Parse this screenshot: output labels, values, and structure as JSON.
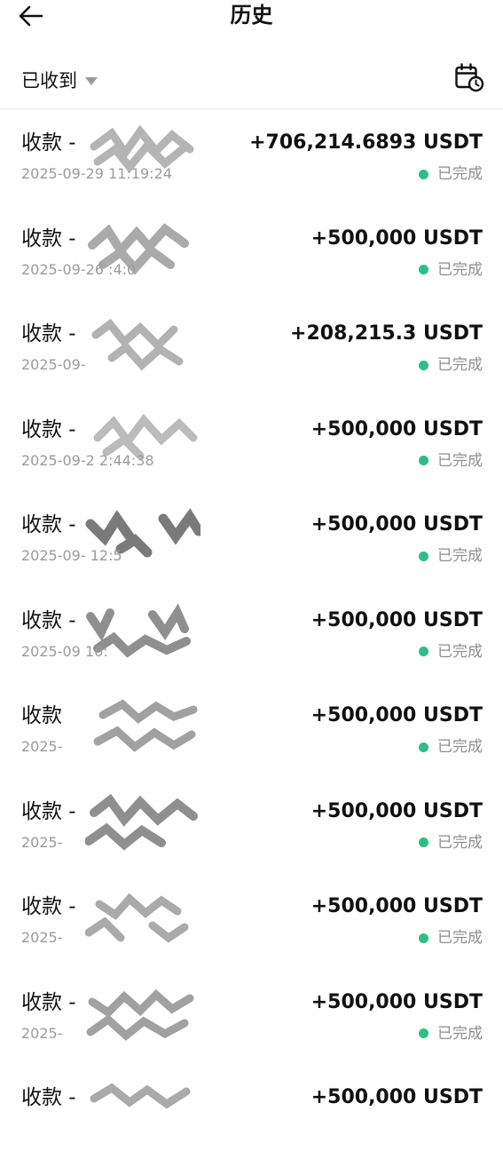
{
  "header": {
    "title": "历史"
  },
  "filter": {
    "label": "已收到"
  },
  "colors": {
    "success": "#2ebd85",
    "muted_text": "#9b9b9b"
  },
  "icons": {
    "back": "arrow-left-icon",
    "calendar": "calendar-clock-icon",
    "dropdown": "caret-down-icon"
  },
  "transactions": [
    {
      "title": "收款 -",
      "time": "2025-09-29 11:19:24",
      "amount": "+706,214.6893 USDT",
      "status": "已完成"
    },
    {
      "title": "收款 -",
      "time": "2025-09-26 :4:0",
      "amount": "+500,000 USDT",
      "status": "已完成"
    },
    {
      "title": "收款 -",
      "time": "2025-09-",
      "amount": "+208,215.3 USDT",
      "status": "已完成"
    },
    {
      "title": "收款 -",
      "time": "2025-09-2 2:44:38",
      "amount": "+500,000 USDT",
      "status": "已完成"
    },
    {
      "title": "收款 -",
      "time": "2025-09- 12:5",
      "amount": "+500,000 USDT",
      "status": "已完成"
    },
    {
      "title": "收款 -",
      "time": "2025-09 16:",
      "amount": "+500,000 USDT",
      "status": "已完成"
    },
    {
      "title": "收款",
      "time": "2025-",
      "amount": "+500,000 USDT",
      "status": "已完成"
    },
    {
      "title": "收款 -",
      "time": "2025-",
      "amount": "+500,000 USDT",
      "status": "已完成"
    },
    {
      "title": "收款 -",
      "time": "2025-",
      "amount": "+500,000 USDT",
      "status": "已完成"
    },
    {
      "title": "收款 -",
      "time": "2025-",
      "amount": "+500,000 USDT",
      "status": "已完成"
    },
    {
      "title": "收款 -",
      "time": "",
      "amount": "+500,000 USDT",
      "status": ""
    }
  ]
}
